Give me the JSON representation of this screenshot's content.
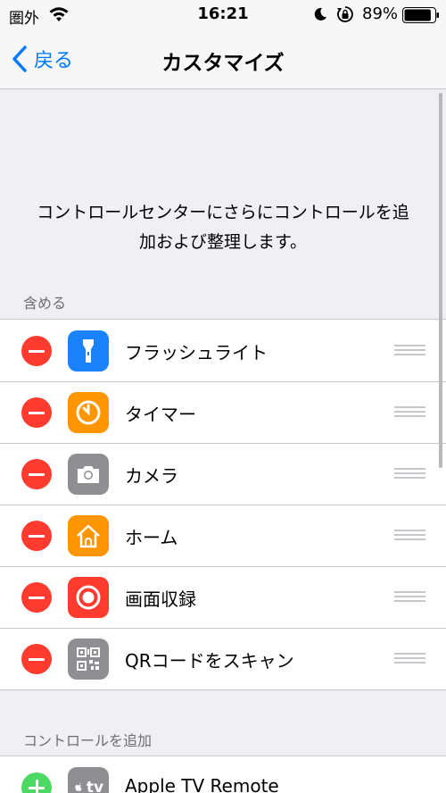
{
  "status_bar": {
    "carrier": "圏外",
    "time": "16:21",
    "battery": "89%",
    "battery_level": 0.89
  },
  "nav": {
    "back_label": "戻る",
    "title": "カスタマイズ"
  },
  "description": "コントロールセンターにさらにコントロールを追加および整理します。",
  "sections": {
    "include_header": "含める",
    "more_header": "コントロールを追加"
  },
  "included": [
    {
      "label": "フラッシュライト",
      "icon": "flashlight-icon",
      "color": "#1a82fb"
    },
    {
      "label": "タイマー",
      "icon": "timer-icon",
      "color": "#ff9500"
    },
    {
      "label": "カメラ",
      "icon": "camera-icon",
      "color": "#8e8e93"
    },
    {
      "label": "ホーム",
      "icon": "home-icon",
      "color": "#ff9500"
    },
    {
      "label": "画面収録",
      "icon": "screen-record-icon",
      "color": "#ff3b30"
    },
    {
      "label": "QRコードをスキャン",
      "icon": "qr-code-icon",
      "color": "#8e8e93"
    }
  ],
  "more": [
    {
      "label": "Apple TV Remote",
      "icon": "apple-tv-icon",
      "color": "#8e8e93",
      "icon_text": "tv"
    }
  ],
  "colors": {
    "accent": "#007aff",
    "remove": "#ff3b30",
    "add": "#4cd964"
  }
}
